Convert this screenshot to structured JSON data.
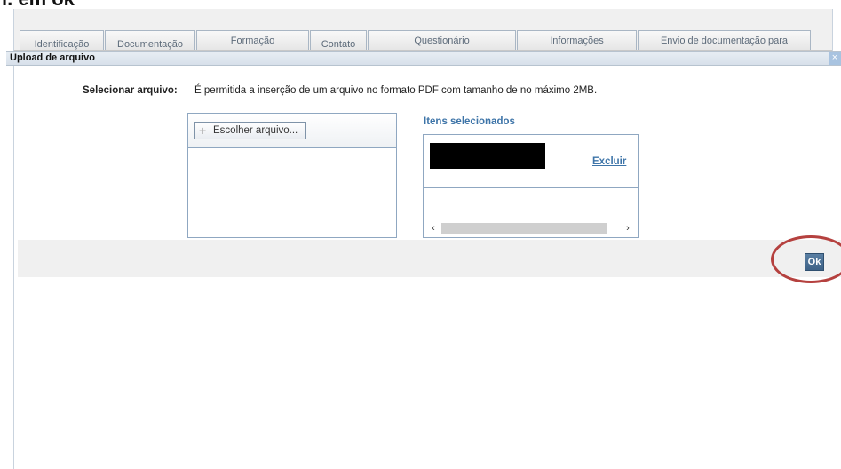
{
  "top_caption": "ı. em ok",
  "tabs": [
    {
      "label": "Identificação"
    },
    {
      "label": "Documentação"
    },
    {
      "label": "Formação"
    },
    {
      "label": "Contato"
    },
    {
      "label": "Questionário"
    },
    {
      "label": "Informações"
    },
    {
      "label": "Envio de documentação para"
    }
  ],
  "dialog": {
    "title": "Upload de arquivo",
    "close_symbol": "×"
  },
  "upload": {
    "select_label": "Selecionar arquivo:",
    "info_text": "É permitida a inserção de um arquivo no formato PDF com tamanho de no máximo 2MB.",
    "choose_button_label": "Escolher arquivo...",
    "plus_symbol": "+"
  },
  "selected_items": {
    "title": "Itens selecionados",
    "delete_label": "Excluir",
    "scroll_left": "‹",
    "scroll_right": "›"
  },
  "footer": {
    "ok_label": "Ok",
    "highlight_color": "#b5413f"
  }
}
